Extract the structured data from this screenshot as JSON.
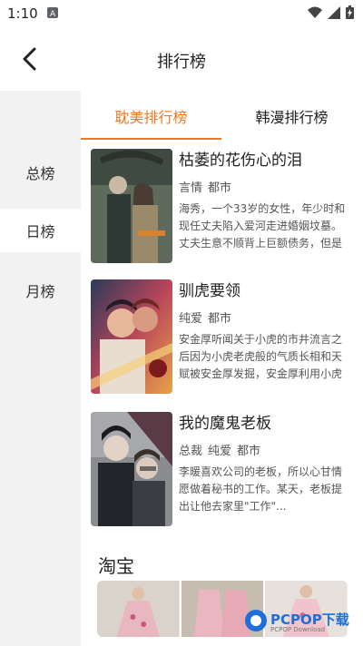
{
  "status": {
    "time": "1:10"
  },
  "header": {
    "title": "排行榜"
  },
  "sidebar": {
    "items": [
      {
        "label": "总榜"
      },
      {
        "label": "日榜"
      },
      {
        "label": "月榜"
      }
    ],
    "active_index": 1
  },
  "tabs": [
    {
      "label": "耽美排行榜"
    },
    {
      "label": "韩漫排行榜"
    }
  ],
  "books": [
    {
      "title": "枯萎的花伤心的泪",
      "tags": [
        "言情",
        "都市"
      ],
      "desc": "海秀，一个33岁的女性，年少时和现任丈夫陷入爱河走进婚姻坟墓。丈夫生意不顺背上巨额债务，但是"
    },
    {
      "title": "驯虎要领",
      "tags": [
        "纯爱",
        "都市"
      ],
      "desc": "安金厚听闻关于小虎的市井流言之后因为小虎老虎般的气质长相和天赋被安金厚发掘，安金厚利用小虎"
    },
    {
      "title": "我的魔鬼老板",
      "tags": [
        "总裁",
        "纯爱",
        "都市"
      ],
      "desc": "李暖喜欢公司的老板，所以心甘情愿做着秘书的工作。某天，老板提出让他去家里\"工作\"..."
    }
  ],
  "taobao": {
    "title": "淘宝"
  },
  "watermark": {
    "text": "PCPOP下载",
    "sub": "PCPOP Download"
  },
  "colors": {
    "accent": "#f07a22",
    "sidebar_bg": "#f2f2f2"
  }
}
